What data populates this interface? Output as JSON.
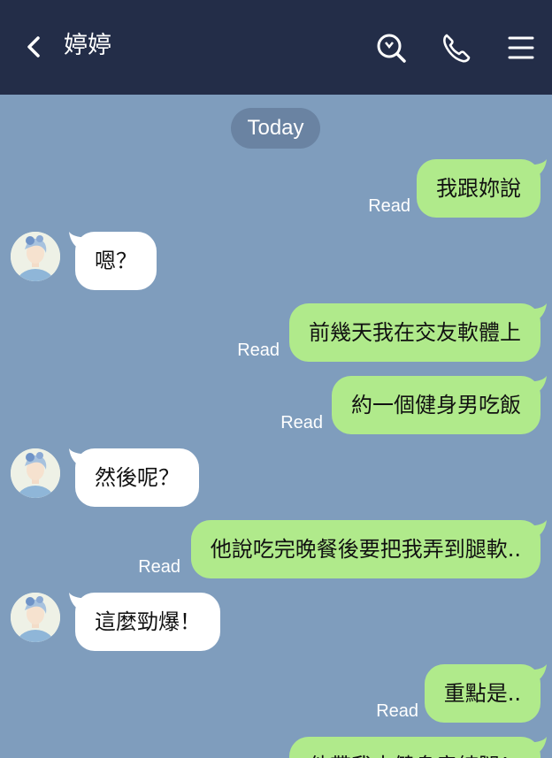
{
  "header": {
    "title": "婷婷",
    "icons": [
      "back-icon",
      "search-icon",
      "phone-icon",
      "menu-icon"
    ],
    "background": "#232d48"
  },
  "chat": {
    "date_label": "Today",
    "read_label": "Read",
    "colors": {
      "background": "#7f9dbd",
      "outgoing": "#b0ea8b",
      "incoming": "#ffffff"
    },
    "messages": [
      {
        "direction": "out",
        "text": "我跟妳說",
        "status": "Read"
      },
      {
        "direction": "in",
        "text": "嗯？"
      },
      {
        "direction": "out",
        "text": "前幾天我在交友軟體上",
        "status": "Read"
      },
      {
        "direction": "out",
        "text": "約一個健身男吃飯",
        "status": "Read"
      },
      {
        "direction": "in",
        "text": "然後呢？"
      },
      {
        "direction": "out",
        "text": "他說吃完晚餐後要把我弄到腿軟..",
        "status": "Read"
      },
      {
        "direction": "in",
        "text": "這麼勁爆！"
      },
      {
        "direction": "out",
        "text": "重點是..",
        "status": "Read"
      },
      {
        "direction": "out",
        "text": "他帶我去健身房練腿！"
      }
    ]
  }
}
